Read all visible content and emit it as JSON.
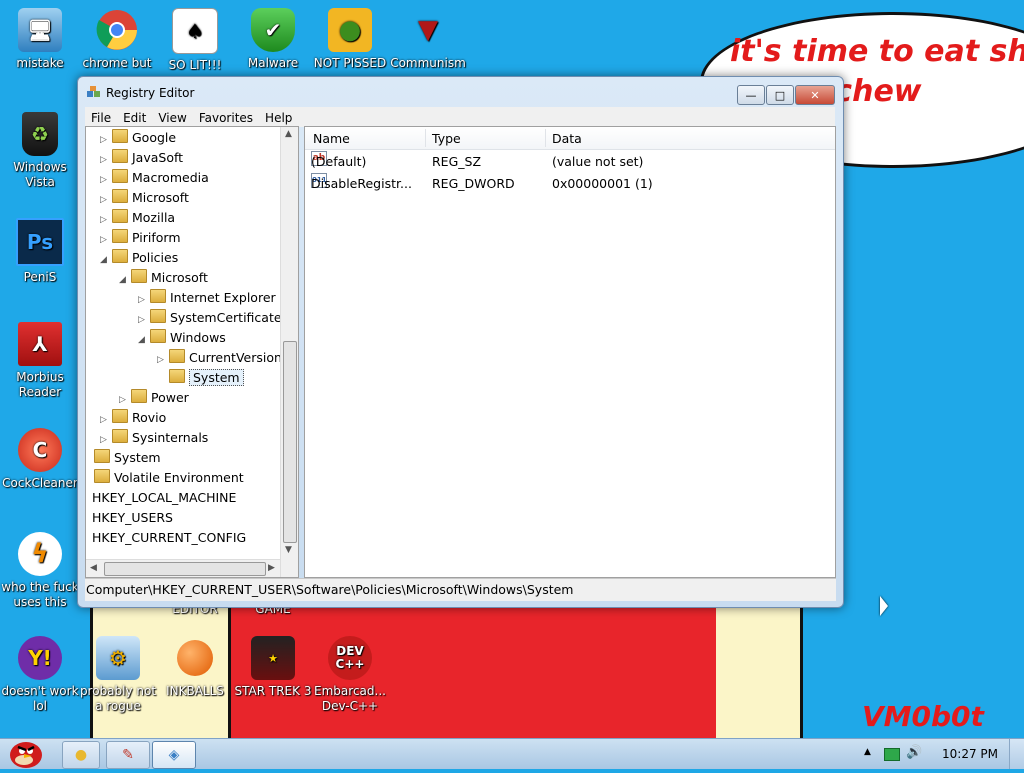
{
  "wallpaper": {
    "bubble_text": "it's time to eat shit\ne and chew\ngum",
    "signature": "VM0b0t",
    "colors": {
      "sky": "#1fa8e8",
      "red": "#e8252b",
      "cream": "#fbf5c8",
      "text_red": "#e31b1b"
    }
  },
  "desktop_icons": [
    {
      "label": "mistake",
      "icon": "computer-update-icon"
    },
    {
      "label": "chrome but",
      "icon": "chrome-icon"
    },
    {
      "label": "SO LIT!!!",
      "icon": "solitaire-icon"
    },
    {
      "label": "Malware",
      "icon": "shield-check-icon"
    },
    {
      "label": "NOT PISSED",
      "icon": "green-pig-icon"
    },
    {
      "label": "Communism",
      "icon": "red-emblem-icon"
    },
    {
      "label": "Windows Vista",
      "icon": "recycle-bin-icon"
    },
    {
      "label": "PeniS",
      "icon": "photoshop-icon",
      "glyph": "Ps"
    },
    {
      "label": "Morbius Reader",
      "icon": "pdf-reader-icon"
    },
    {
      "label": "CockCleaner",
      "icon": "ccleaner-icon"
    },
    {
      "label": "who the fuck uses this",
      "icon": "winamp-bolt-icon"
    },
    {
      "label": "doesn't work lol",
      "icon": "yahoo-messenger-icon",
      "glyph": "Y!"
    },
    {
      "label": "probably not a rogue",
      "icon": "gear-monitor-icon"
    },
    {
      "label": "INKBALLS",
      "icon": "inkball-icon"
    },
    {
      "label": "STAR TREK 3",
      "icon": "star-wars-game-icon"
    },
    {
      "label": "Embarcad... Dev-C++",
      "icon": "devcpp-icon",
      "glyph": "DEV C++"
    }
  ],
  "desktop_partial_labels": {
    "editor": "EDITOR",
    "game": "GAME"
  },
  "window": {
    "title": "Registry Editor",
    "buttons": {
      "minimize": "—",
      "maximize": "□",
      "close": "✕"
    },
    "menu": [
      "File",
      "Edit",
      "View",
      "Favorites",
      "Help"
    ],
    "tree": [
      {
        "label": "Google",
        "expander": "▷"
      },
      {
        "label": "JavaSoft",
        "expander": "▷"
      },
      {
        "label": "Macromedia",
        "expander": "▷"
      },
      {
        "label": "Microsoft",
        "expander": "▷"
      },
      {
        "label": "Mozilla",
        "expander": "▷"
      },
      {
        "label": "Piriform",
        "expander": "▷"
      },
      {
        "label": "Policies",
        "expander": "◢"
      },
      {
        "label": "Microsoft",
        "expander": "◢"
      },
      {
        "label": "Internet Explorer",
        "expander": "▷"
      },
      {
        "label": "SystemCertificates",
        "expander": "▷"
      },
      {
        "label": "Windows",
        "expander": "◢"
      },
      {
        "label": "CurrentVersion",
        "expander": "▷"
      },
      {
        "label": "System",
        "expander": "",
        "selected": true
      },
      {
        "label": "Power",
        "expander": "▷"
      },
      {
        "label": "Rovio",
        "expander": "▷"
      },
      {
        "label": "Sysinternals",
        "expander": "▷"
      },
      {
        "label": "System",
        "expander": ""
      },
      {
        "label": "Volatile Environment",
        "expander": ""
      },
      {
        "label": "HKEY_LOCAL_MACHINE",
        "expander": ""
      },
      {
        "label": "HKEY_USERS",
        "expander": ""
      },
      {
        "label": "HKEY_CURRENT_CONFIG",
        "expander": ""
      }
    ],
    "columns": {
      "name": "Name",
      "type": "Type",
      "data": "Data"
    },
    "values": [
      {
        "name": "(Default)",
        "type": "REG_SZ",
        "data": "(value not set)",
        "icon": "string-value-icon",
        "glyph": "ab"
      },
      {
        "name": "DisableRegistr...",
        "type": "REG_DWORD",
        "data": "0x00000001 (1)",
        "icon": "binary-value-icon",
        "glyph": "011"
      }
    ],
    "status_path": "Computer\\HKEY_CURRENT_USER\\Software\\Policies\\Microsoft\\Windows\\System"
  },
  "taskbar": {
    "clock": "10:27 PM",
    "tray_chevron": "▲",
    "volume_glyph": "🔊"
  }
}
